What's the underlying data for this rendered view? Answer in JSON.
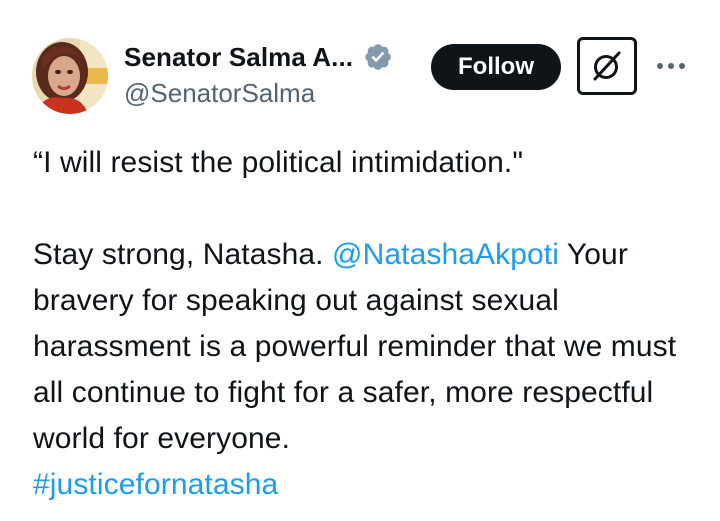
{
  "author": {
    "display_name": "Senator Salma A...",
    "handle": "@SenatorSalma",
    "avatar_icon": "profile-photo",
    "verified_icon": "verified-badge-icon",
    "verified_color": "#829aab"
  },
  "actions": {
    "follow_label": "Follow",
    "grok_icon": "grok-icon",
    "more_icon": "more-options-icon"
  },
  "tweet": {
    "line1": "“I will resist the political intimidation.\"",
    "para2_start": "Stay strong, Natasha. ",
    "mention": "@NatashaAkpoti",
    "para2_rest": " Your bravery for speaking out against sexual harassment is a powerful reminder that we must all continue to fight for a safer, more respectful world for everyone.",
    "hashtag": "#justicefornatasha"
  },
  "colors": {
    "link": "#1d9bf0",
    "text": "#0f1419",
    "secondary": "#536471",
    "follow_bg": "#0f1419"
  }
}
